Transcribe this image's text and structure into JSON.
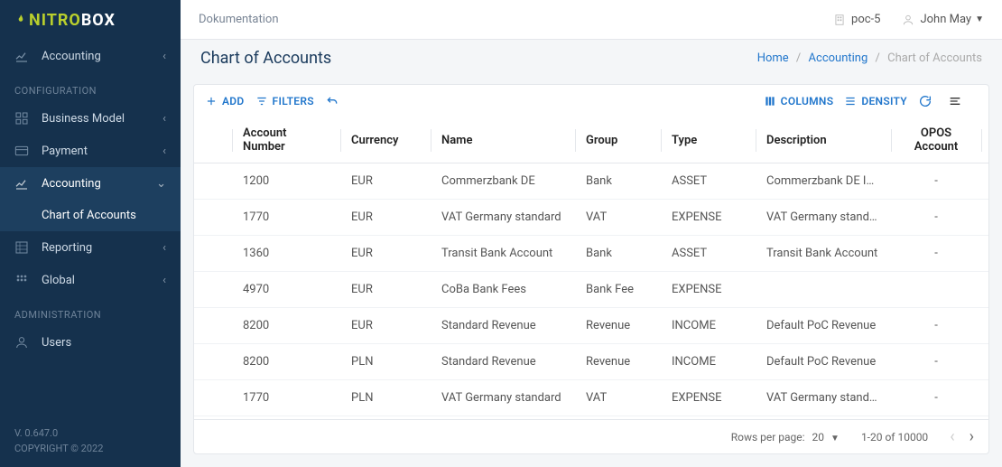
{
  "logo": {
    "text1": "NITRO",
    "text2": "BOX"
  },
  "sidebar": {
    "top_item": {
      "label": "Accounting"
    },
    "groups": [
      {
        "label": "CONFIGURATION",
        "items": [
          {
            "label": "Business Model",
            "expanded": false
          },
          {
            "label": "Payment",
            "expanded": false
          },
          {
            "label": "Accounting",
            "expanded": true,
            "children": [
              {
                "label": "Chart of Accounts"
              }
            ]
          },
          {
            "label": "Reporting",
            "expanded": false
          },
          {
            "label": "Global",
            "expanded": false
          }
        ]
      },
      {
        "label": "ADMINISTRATION",
        "items": [
          {
            "label": "Users",
            "expanded": false
          }
        ]
      }
    ],
    "footer": {
      "version": "V. 0.647.0",
      "copyright": "COPYRIGHT © 2022"
    }
  },
  "topbar": {
    "doc": "Dokumentation",
    "tenant": "poc-5",
    "user": "John May"
  },
  "page": {
    "title": "Chart of Accounts",
    "breadcrumb": [
      "Home",
      "Accounting",
      "Chart of Accounts"
    ]
  },
  "toolbar": {
    "add": "ADD",
    "filters": "FILTERS",
    "columns": "COLUMNS",
    "density": "DENSITY"
  },
  "table": {
    "columns": [
      "Account Number",
      "Currency",
      "Name",
      "Group",
      "Type",
      "Description",
      "OPOS Account"
    ],
    "rows": [
      {
        "num": "1200",
        "cur": "EUR",
        "name": "Commerzbank DE",
        "group": "Bank",
        "type": "ASSET",
        "desc": "Commerzbank DE IBAN",
        "opos": "-"
      },
      {
        "num": "1770",
        "cur": "EUR",
        "name": "VAT Germany standard",
        "group": "VAT",
        "type": "EXPENSE",
        "desc": "VAT Germany standard",
        "opos": "-"
      },
      {
        "num": "1360",
        "cur": "EUR",
        "name": "Transit Bank Account",
        "group": "Bank",
        "type": "ASSET",
        "desc": "Transit Bank Account",
        "opos": "-"
      },
      {
        "num": "4970",
        "cur": "EUR",
        "name": "CoBa Bank Fees",
        "group": "Bank Fee",
        "type": "EXPENSE",
        "desc": "",
        "opos": ""
      },
      {
        "num": "8200",
        "cur": "EUR",
        "name": "Standard Revenue",
        "group": "Revenue",
        "type": "INCOME",
        "desc": "Default PoC Revenue",
        "opos": "-"
      },
      {
        "num": "8200",
        "cur": "PLN",
        "name": "Standard Revenue",
        "group": "Revenue",
        "type": "INCOME",
        "desc": "Default PoC Revenue",
        "opos": "-"
      },
      {
        "num": "1770",
        "cur": "PLN",
        "name": "VAT Germany standard",
        "group": "VAT",
        "type": "EXPENSE",
        "desc": "VAT Germany standard",
        "opos": "-"
      }
    ]
  },
  "paginator": {
    "rows_label": "Rows per page:",
    "page_size": "20",
    "range": "1-20 of 10000"
  }
}
